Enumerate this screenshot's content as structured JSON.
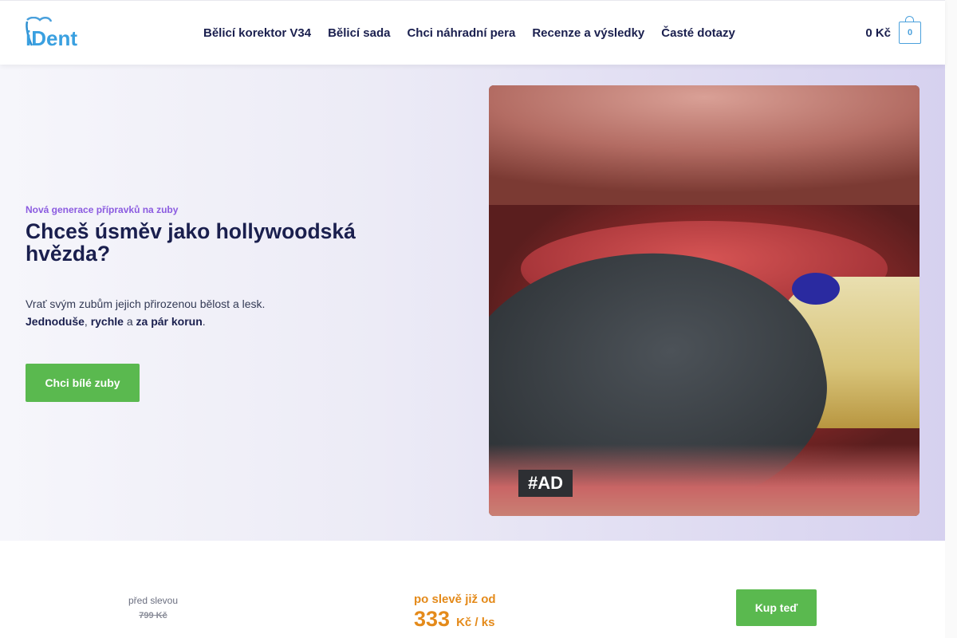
{
  "header": {
    "logo_text": "iDent",
    "nav": [
      {
        "label": "Bělicí korektor V34"
      },
      {
        "label": "Bělicí sada"
      },
      {
        "label": "Chci náhradní pera"
      },
      {
        "label": "Recenze a výsledky"
      },
      {
        "label": "Časté dotazy"
      }
    ],
    "cart_total": "0 Kč",
    "cart_count": "0"
  },
  "hero": {
    "eyebrow": "Nová generace přípravků na zuby",
    "headline": "Chceš úsměv jako hollywoodská hvězda?",
    "intro_line1": "Vrať svým zubům jejich přirozenou bělost a lesk.",
    "intro_b1": "Jednoduše",
    "intro_sep1": ", ",
    "intro_b2": "rychle",
    "intro_sep2": " a ",
    "intro_b3": "za pár korun",
    "intro_end": ".",
    "cta_label": "Chci bílé zuby",
    "ad_tag": "#AD"
  },
  "pricing": {
    "before_label": "před slevou",
    "before_price": "799 Kč",
    "after_label": "po slevě již od",
    "after_price": "333",
    "after_unit": "Kč / ks",
    "buy_label": "Kup teď"
  },
  "colors": {
    "accent_green": "#5ab94f",
    "brand_blue": "#4aa0dc",
    "price_orange": "#e48a1a",
    "eyebrow_purple": "#8b5be0"
  }
}
